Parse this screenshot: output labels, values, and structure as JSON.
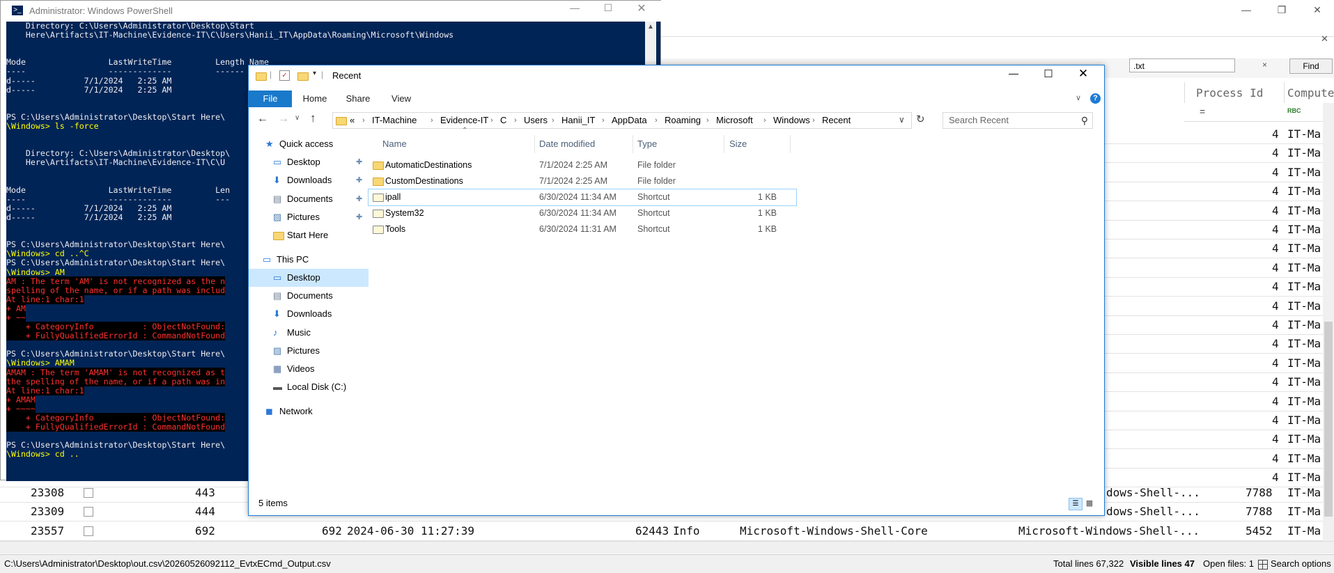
{
  "bg_app": {
    "search_value": ".txt",
    "search_clear": "×",
    "find_label": "Find",
    "col_process_id": "Process Id",
    "col_computer": "Compute",
    "filter_eq": "=",
    "filter_abc": "RBC",
    "computer_trunc": "IT-Ma",
    "pid_four": "4",
    "rows": [
      {
        "id": "23308",
        "line": "443",
        "provider_trunc": "dows-Shell-...",
        "pid": "7788",
        "comp": "IT-Ma"
      },
      {
        "id": "23309",
        "line": "444",
        "provider_trunc": "dows-Shell-...",
        "pid": "7788",
        "comp": "IT-Ma"
      },
      {
        "id": "23557",
        "line": "692",
        "line2": "692",
        "time": "2024-06-30 11:27:39",
        "event_id": "62443",
        "level": "Info",
        "provider": "Microsoft-Windows-Shell-Core",
        "channel_trunc": "Microsoft-Windows-Shell-...",
        "pid": "5452",
        "comp": "IT-Ma"
      }
    ],
    "status": {
      "path": "C:\\Users\\Administrator\\Desktop\\out.csv\\20260526092112_EvtxECmd_Output.csv",
      "total_lines": "Total lines 67,322",
      "visible_lines": "Visible lines 47",
      "open_files": "Open files: 1",
      "search_options": "Search options"
    }
  },
  "powershell": {
    "title": "Administrator: Windows PowerShell",
    "lines": [
      {
        "t": "    Directory: C:\\Users\\Administrator\\Desktop\\Start",
        "c": ""
      },
      {
        "t": "    Here\\Artifacts\\IT-Machine\\Evidence-IT\\C\\Users\\Hanii_IT\\AppData\\Roaming\\Microsoft\\Windows",
        "c": ""
      },
      {
        "t": "",
        "c": ""
      },
      {
        "t": "",
        "c": ""
      },
      {
        "t": "Mode                 LastWriteTime         Length Name",
        "c": ""
      },
      {
        "t": "----                 -------------         ------ ----",
        "c": ""
      },
      {
        "t": "d-----          7/1/2024   2:25 AM",
        "c": ""
      },
      {
        "t": "d-----          7/1/2024   2:25 AM",
        "c": ""
      },
      {
        "t": "",
        "c": ""
      },
      {
        "t": "",
        "c": ""
      },
      {
        "t": "PS C:\\Users\\Administrator\\Desktop\\Start Here\\",
        "c": ""
      },
      {
        "t": "\\Windows> ls -force",
        "c": "cmd"
      },
      {
        "t": "",
        "c": ""
      },
      {
        "t": "",
        "c": ""
      },
      {
        "t": "    Directory: C:\\Users\\Administrator\\Desktop\\",
        "c": ""
      },
      {
        "t": "    Here\\Artifacts\\IT-Machine\\Evidence-IT\\C\\U",
        "c": ""
      },
      {
        "t": "",
        "c": ""
      },
      {
        "t": "",
        "c": ""
      },
      {
        "t": "Mode                 LastWriteTime         Len",
        "c": ""
      },
      {
        "t": "----                 -------------         ---",
        "c": ""
      },
      {
        "t": "d-----          7/1/2024   2:25 AM",
        "c": ""
      },
      {
        "t": "d-----          7/1/2024   2:25 AM",
        "c": ""
      },
      {
        "t": "",
        "c": ""
      },
      {
        "t": "",
        "c": ""
      },
      {
        "t": "PS C:\\Users\\Administrator\\Desktop\\Start Here\\",
        "c": ""
      },
      {
        "t": "\\Windows> cd ..^C",
        "c": "cmd"
      },
      {
        "t": "PS C:\\Users\\Administrator\\Desktop\\Start Here\\",
        "c": ""
      },
      {
        "t": "\\Windows> AM",
        "c": "cmd"
      },
      {
        "t": "AM : The term 'AM' is not recognized as the n",
        "c": "err"
      },
      {
        "t": "spelling of the name, or if a path was includ",
        "c": "err"
      },
      {
        "t": "At line:1 char:1",
        "c": "err"
      },
      {
        "t": "+ AM",
        "c": "err"
      },
      {
        "t": "+ ~~",
        "c": "err"
      },
      {
        "t": "    + CategoryInfo          : ObjectNotFound:",
        "c": "err"
      },
      {
        "t": "    + FullyQualifiedErrorId : CommandNotFound",
        "c": "err"
      },
      {
        "t": "",
        "c": ""
      },
      {
        "t": "PS C:\\Users\\Administrator\\Desktop\\Start Here\\",
        "c": ""
      },
      {
        "t": "\\Windows> AMAM",
        "c": "cmd"
      },
      {
        "t": "AMAM : The term 'AMAM' is not recognized as t",
        "c": "err"
      },
      {
        "t": "the spelling of the name, or if a path was in",
        "c": "err"
      },
      {
        "t": "At line:1 char:1",
        "c": "err"
      },
      {
        "t": "+ AMAM",
        "c": "err"
      },
      {
        "t": "+ ~~~~",
        "c": "err"
      },
      {
        "t": "    + CategoryInfo          : ObjectNotFound:",
        "c": "err"
      },
      {
        "t": "    + FullyQualifiedErrorId : CommandNotFound",
        "c": "err"
      },
      {
        "t": "",
        "c": ""
      },
      {
        "t": "PS C:\\Users\\Administrator\\Desktop\\Start Here\\",
        "c": ""
      },
      {
        "t": "\\Windows> cd ..",
        "c": "cmd"
      }
    ]
  },
  "explorer": {
    "title": "Recent",
    "ribbon_tabs": [
      "File",
      "Home",
      "Share",
      "View"
    ],
    "breadcrumb": [
      "«",
      "IT-Machine",
      "Evidence-IT",
      "C",
      "Users",
      "Hanii_IT",
      "AppData",
      "Roaming",
      "Microsoft",
      "Windows",
      "Recent"
    ],
    "search_placeholder": "Search Recent",
    "nav": [
      {
        "label": "Quick access",
        "icon": "star-icon",
        "pin": false
      },
      {
        "label": "Desktop",
        "icon": "desktop-icon",
        "pin": true
      },
      {
        "label": "Downloads",
        "icon": "download-icon",
        "pin": true
      },
      {
        "label": "Documents",
        "icon": "documents-icon",
        "pin": true
      },
      {
        "label": "Pictures",
        "icon": "pictures-icon",
        "pin": true
      },
      {
        "label": "Start Here",
        "icon": "folder-icon",
        "pin": false
      },
      {
        "label": "This PC",
        "icon": "computer-icon",
        "pin": false
      },
      {
        "label": "Desktop",
        "icon": "desktop-icon",
        "pin": false
      },
      {
        "label": "Documents",
        "icon": "documents-icon",
        "pin": false
      },
      {
        "label": "Downloads",
        "icon": "download-icon",
        "pin": false
      },
      {
        "label": "Music",
        "icon": "music-icon",
        "pin": false
      },
      {
        "label": "Pictures",
        "icon": "pictures-icon",
        "pin": false
      },
      {
        "label": "Videos",
        "icon": "videos-icon",
        "pin": false
      },
      {
        "label": "Local Disk (C:)",
        "icon": "drive-icon",
        "pin": false
      },
      {
        "label": "Network",
        "icon": "network-icon",
        "pin": false
      }
    ],
    "columns": [
      "Name",
      "Date modified",
      "Type",
      "Size"
    ],
    "files": [
      {
        "name": "AutomaticDestinations",
        "date": "7/1/2024 2:25 AM",
        "type": "File folder",
        "size": "",
        "icon": "folder"
      },
      {
        "name": "CustomDestinations",
        "date": "7/1/2024 2:25 AM",
        "type": "File folder",
        "size": "",
        "icon": "folder"
      },
      {
        "name": "ipall",
        "date": "6/30/2024 11:34 AM",
        "type": "Shortcut",
        "size": "1 KB",
        "icon": "shortcut"
      },
      {
        "name": "System32",
        "date": "6/30/2024 11:34 AM",
        "type": "Shortcut",
        "size": "1 KB",
        "icon": "shortcut"
      },
      {
        "name": "Tools",
        "date": "6/30/2024 11:31 AM",
        "type": "Shortcut",
        "size": "1 KB",
        "icon": "shortcut"
      }
    ],
    "status": "5 items"
  },
  "colors": {
    "ps_bg": "#012456",
    "accent": "#1e7bd4",
    "file_tab": "#1979ca"
  }
}
